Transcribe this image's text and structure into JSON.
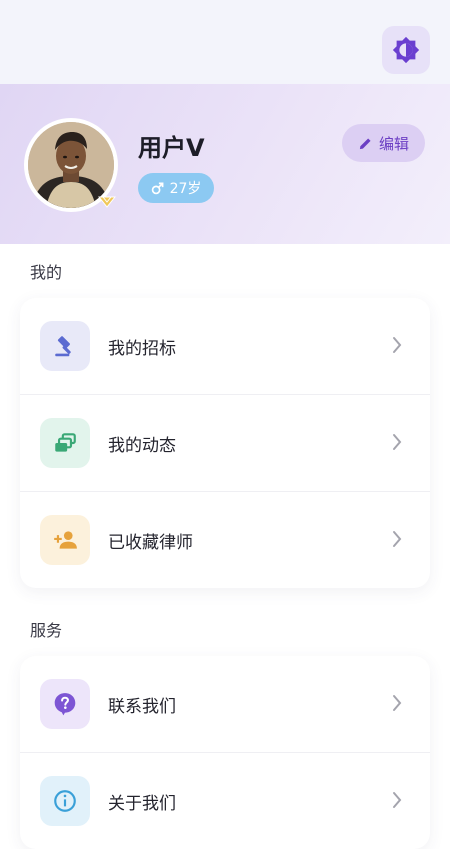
{
  "profile": {
    "username": "用户V",
    "age": "27岁",
    "gender_icon": "male-icon",
    "edit_label": "编辑"
  },
  "sections": {
    "mine_title": "我的",
    "service_title": "服务"
  },
  "mine_items": [
    {
      "label": "我的招标",
      "icon": "gavel-icon",
      "color": "#5b6bd1"
    },
    {
      "label": "我的动态",
      "icon": "layers-icon",
      "color": "#3aa876"
    },
    {
      "label": "已收藏律师",
      "icon": "person-add-icon",
      "color": "#e6a23c"
    }
  ],
  "service_items": [
    {
      "label": "联系我们",
      "icon": "help-bubble-icon",
      "color": "#7d55d4"
    },
    {
      "label": "关于我们",
      "icon": "info-icon",
      "color": "#3aa0d8"
    }
  ],
  "colors": {
    "accent": "#6c3fc4",
    "age_badge": "#8cc9f2"
  }
}
